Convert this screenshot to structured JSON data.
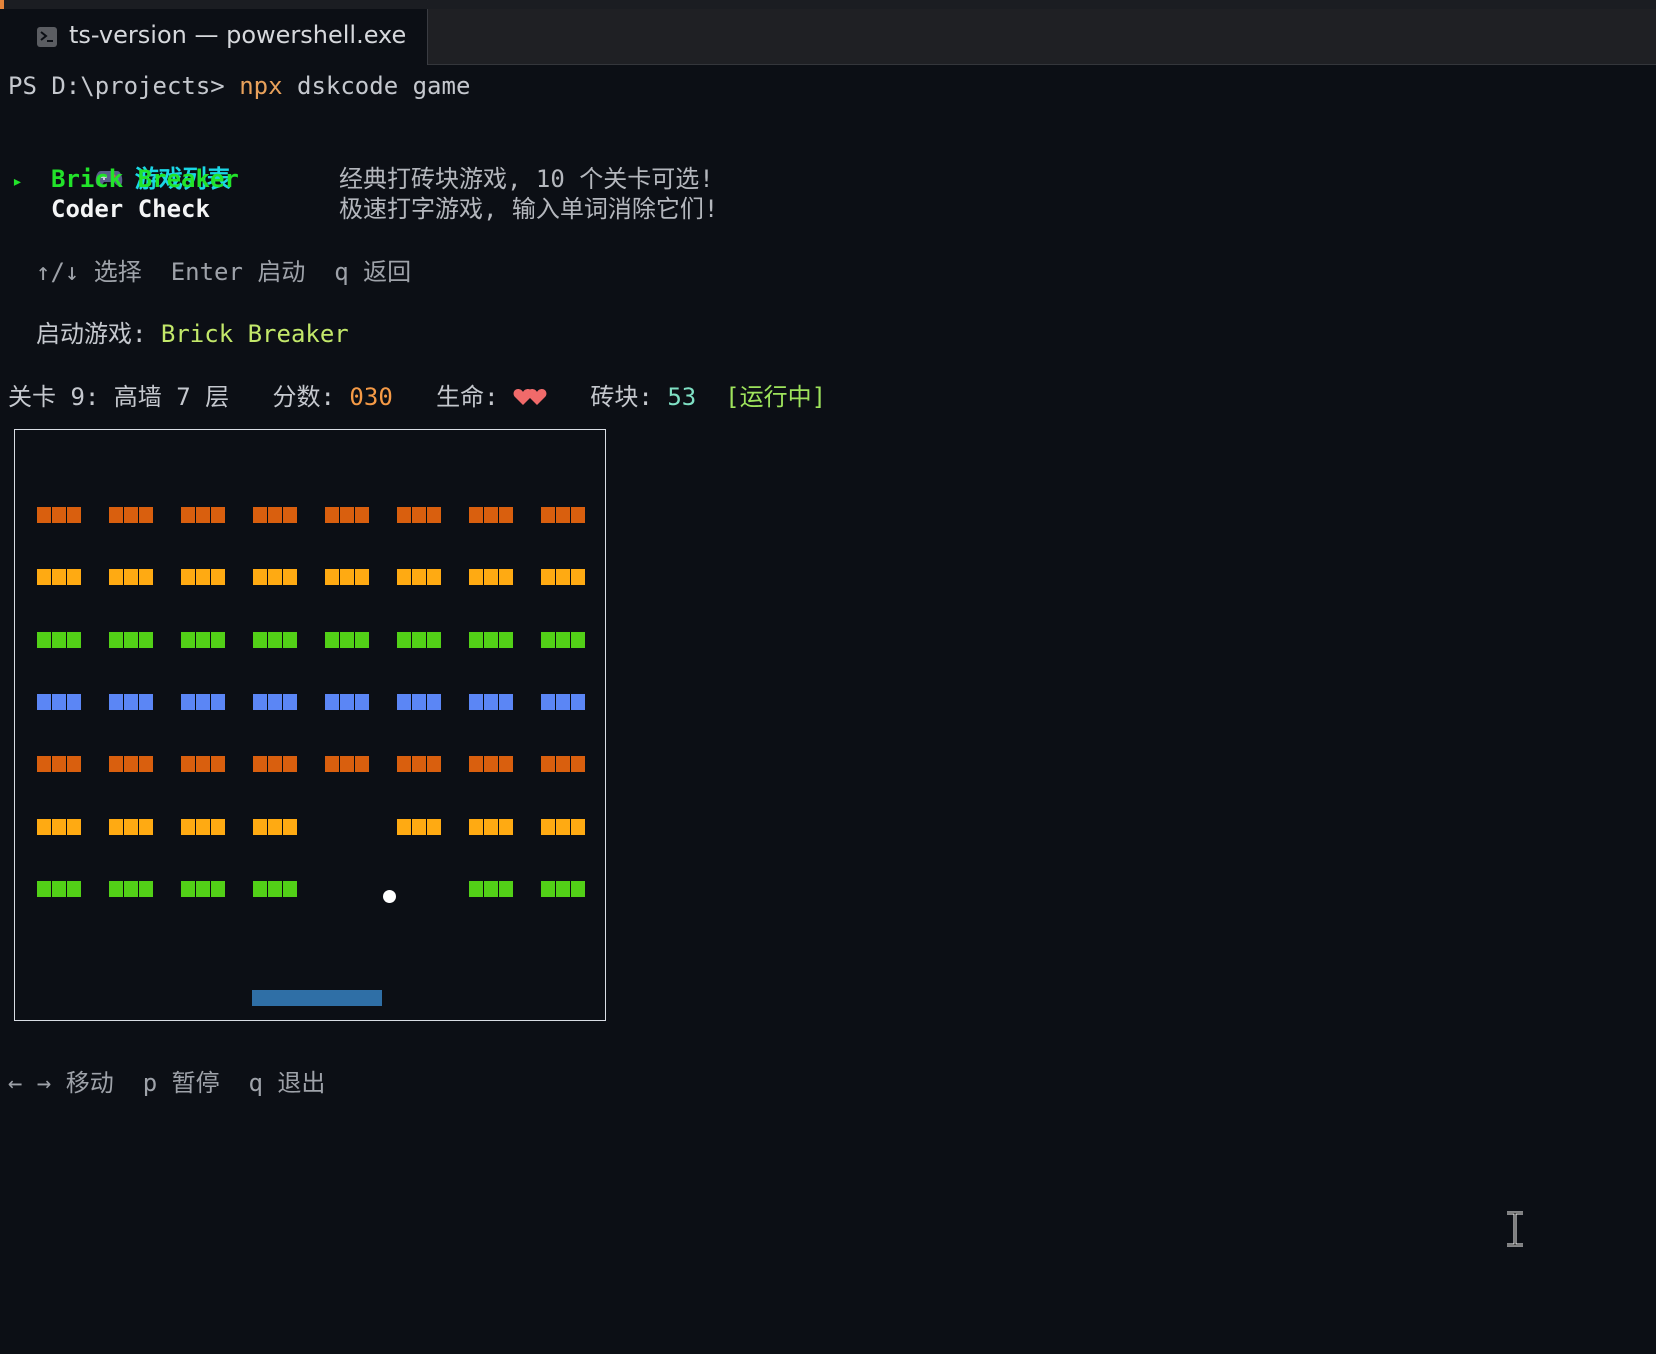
{
  "window": {
    "tab_title": "ts-version — powershell.exe",
    "tab_icon": "terminal-icon"
  },
  "terminal": {
    "prompt": "PS D:\\projects>",
    "command_bin": "npx",
    "command_args": " dskcode game",
    "menu_icon": "gamepad-icon",
    "menu_title": "游戏列表",
    "selector_glyph": "▸",
    "games": [
      {
        "name": "Brick Breaker",
        "desc": "经典打砖块游戏, 10 个关卡可选!"
      },
      {
        "name": "Coder Check",
        "desc": "极速打字游戏, 输入单词消除它们!"
      }
    ],
    "menu_hint": "↑/↓ 选择  Enter 启动  q 返回",
    "launch_label": "启动游戏: ",
    "launch_game": "Brick Breaker"
  },
  "status": {
    "level_label": "关卡 9: 高墙 7 层",
    "score_label": "分数: ",
    "score_value": "030",
    "lives_label": "生命: ",
    "lives_icon": "heart-icon",
    "lives": 2,
    "bricks_label": "砖块: ",
    "bricks_value": "53",
    "state": "[运行中]"
  },
  "game": {
    "brick_colors": [
      "#d95f0e",
      "#ffaa12",
      "#52d017",
      "#5b86f5",
      "#d95f0e",
      "#ffaa12",
      "#52d017"
    ],
    "brick_rows": [
      [
        1,
        1,
        1,
        1,
        1,
        1,
        1,
        1
      ],
      [
        1,
        1,
        1,
        1,
        1,
        1,
        1,
        1
      ],
      [
        1,
        1,
        1,
        1,
        1,
        1,
        1,
        1
      ],
      [
        1,
        1,
        1,
        1,
        1,
        1,
        1,
        1
      ],
      [
        1,
        1,
        1,
        1,
        1,
        1,
        1,
        1
      ],
      [
        1,
        1,
        1,
        1,
        0,
        1,
        1,
        1
      ],
      [
        1,
        1,
        1,
        1,
        0,
        0,
        1,
        1
      ]
    ],
    "controls_hint": "← → 移动  p 暂停  q 退出"
  }
}
